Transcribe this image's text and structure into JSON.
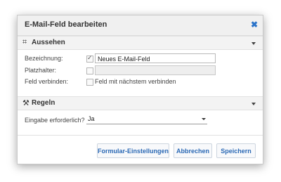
{
  "dialog": {
    "title": "E-Mail-Feld bearbeiten",
    "close_icon": "close-icon"
  },
  "sections": {
    "appearance": {
      "icon": "crop-icon",
      "title": "Aussehen",
      "rows": {
        "name": {
          "label": "Bezeichnung:",
          "checked": true,
          "value": "Neues E-Mail-Feld"
        },
        "placeholder": {
          "label": "Platzhalter:",
          "checked": false,
          "value": ""
        },
        "connect": {
          "label": "Feld verbinden:",
          "checked": false,
          "option_label": "Feld mit nächstem verbinden"
        }
      }
    },
    "rules": {
      "icon": "gavel-icon",
      "title": "Regeln",
      "required": {
        "label": "Eingabe erforderlich?",
        "value": "Ja"
      }
    }
  },
  "buttons": {
    "form_settings": "Formular-Einstellungen",
    "cancel": "Abbrechen",
    "save": "Speichern"
  },
  "colors": {
    "accent": "#2b69b5"
  }
}
